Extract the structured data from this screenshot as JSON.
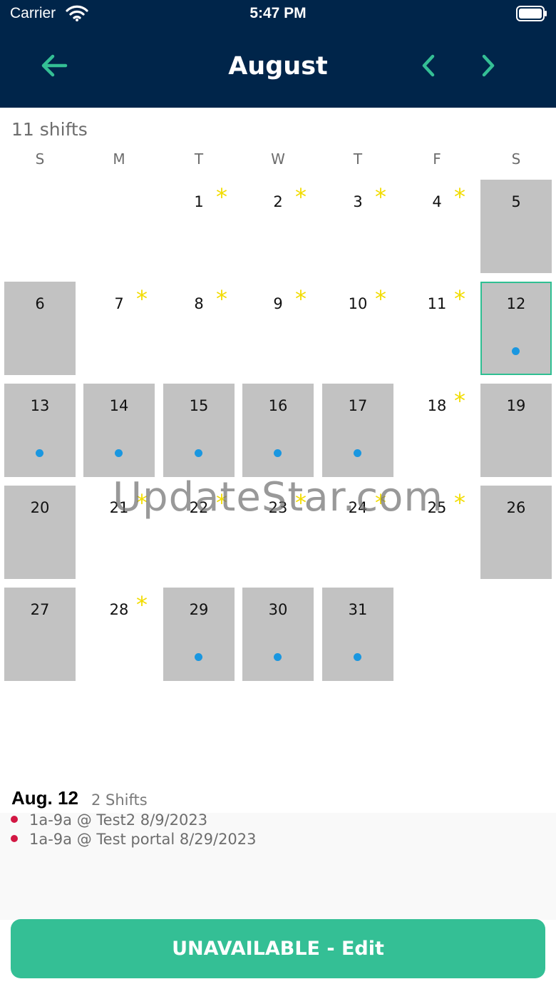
{
  "status_bar": {
    "carrier": "Carrier",
    "time": "5:47 PM"
  },
  "header": {
    "title": "August"
  },
  "summary": {
    "shift_count_label": "11 shifts"
  },
  "calendar": {
    "weekdays": [
      "S",
      "M",
      "T",
      "W",
      "T",
      "F",
      "S"
    ],
    "days": [
      {
        "label": "1",
        "star": true,
        "gray": false,
        "dot": false
      },
      {
        "label": "2",
        "star": true,
        "gray": false,
        "dot": false
      },
      {
        "label": "3",
        "star": true,
        "gray": false,
        "dot": false
      },
      {
        "label": "4",
        "star": true,
        "gray": false,
        "dot": false
      },
      {
        "label": "5",
        "star": false,
        "gray": true,
        "dot": false
      },
      {
        "label": "6",
        "star": false,
        "gray": true,
        "dot": false
      },
      {
        "label": "7",
        "star": true,
        "gray": false,
        "dot": false
      },
      {
        "label": "8",
        "star": true,
        "gray": false,
        "dot": false
      },
      {
        "label": "9",
        "star": true,
        "gray": false,
        "dot": false
      },
      {
        "label": "10",
        "star": true,
        "gray": false,
        "dot": false
      },
      {
        "label": "11",
        "star": true,
        "gray": false,
        "dot": false
      },
      {
        "label": "12",
        "star": false,
        "gray": true,
        "dot": true,
        "selected": true
      },
      {
        "label": "13",
        "star": false,
        "gray": true,
        "dot": true
      },
      {
        "label": "14",
        "star": false,
        "gray": true,
        "dot": true
      },
      {
        "label": "15",
        "star": false,
        "gray": true,
        "dot": true
      },
      {
        "label": "16",
        "star": false,
        "gray": true,
        "dot": true
      },
      {
        "label": "17",
        "star": false,
        "gray": true,
        "dot": true
      },
      {
        "label": "18",
        "star": true,
        "gray": false,
        "dot": false
      },
      {
        "label": "19",
        "star": false,
        "gray": true,
        "dot": false
      },
      {
        "label": "20",
        "star": false,
        "gray": true,
        "dot": false
      },
      {
        "label": "21",
        "star": true,
        "gray": false,
        "dot": false
      },
      {
        "label": "22",
        "star": true,
        "gray": false,
        "dot": false
      },
      {
        "label": "23",
        "star": true,
        "gray": false,
        "dot": false
      },
      {
        "label": "24",
        "star": true,
        "gray": false,
        "dot": false
      },
      {
        "label": "25",
        "star": true,
        "gray": false,
        "dot": false
      },
      {
        "label": "26",
        "star": false,
        "gray": true,
        "dot": false
      },
      {
        "label": "27",
        "star": false,
        "gray": true,
        "dot": false
      },
      {
        "label": "28",
        "star": true,
        "gray": false,
        "dot": false
      },
      {
        "label": "29",
        "star": false,
        "gray": true,
        "dot": true
      },
      {
        "label": "30",
        "star": false,
        "gray": true,
        "dot": true
      },
      {
        "label": "31",
        "star": false,
        "gray": true,
        "dot": true
      }
    ],
    "star_glyph": "*"
  },
  "watermark": "UpdateStar.com",
  "detail": {
    "date": "Aug. 12",
    "count": "2 Shifts",
    "items": [
      "1a-9a @ Test2 8/9/2023",
      "1a-9a @ Test portal 8/29/2023"
    ]
  },
  "action": {
    "label": "UNAVAILABLE - Edit"
  },
  "colors": {
    "header_bg": "#00254a",
    "accent": "#34bf95",
    "star": "#f2dc00",
    "dot": "#1a97e0",
    "bullet": "#d21743",
    "unavailable_cell": "#c2c2c2"
  },
  "icons": {
    "back": "arrow-left-icon",
    "prev": "chevron-left-icon",
    "next": "chevron-right-icon",
    "wifi": "wifi-icon",
    "battery": "battery-icon"
  }
}
